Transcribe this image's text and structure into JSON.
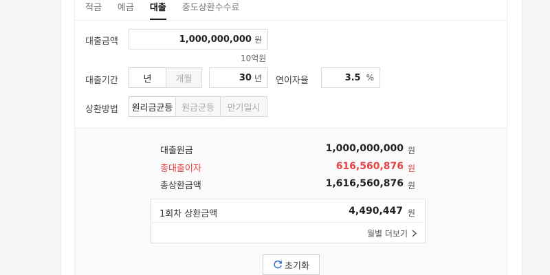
{
  "tabs": [
    "적금",
    "예금",
    "대출",
    "중도상환수수료"
  ],
  "active_tab": "대출",
  "form": {
    "loan_amount_label": "대출금액",
    "loan_amount_value": "1,000,000,000",
    "loan_amount_unit": "원",
    "loan_amount_hint": "10억원",
    "period_label": "대출기간",
    "period_options": [
      "년",
      "개월"
    ],
    "period_selected": "년",
    "period_value": "30",
    "period_unit": "년",
    "rate_label": "연이자율",
    "rate_value": "3.5",
    "rate_unit": "%",
    "method_label": "상환방법",
    "method_options": [
      "원리금균등",
      "원금균등",
      "만기일시"
    ],
    "method_selected": "원리금균등"
  },
  "result": {
    "principal_label": "대출원금",
    "principal_value": "1,000,000,000",
    "interest_label": "총대출이자",
    "interest_value": "616,560,876",
    "total_label": "총상환금액",
    "total_value": "1,616,560,876",
    "won": "원",
    "first_payment_label": "1회차 상환금액",
    "first_payment_value": "4,490,447",
    "monthly_more": "월별 더보기",
    "reset_label": "초기화",
    "accent_red": "#e64545"
  }
}
